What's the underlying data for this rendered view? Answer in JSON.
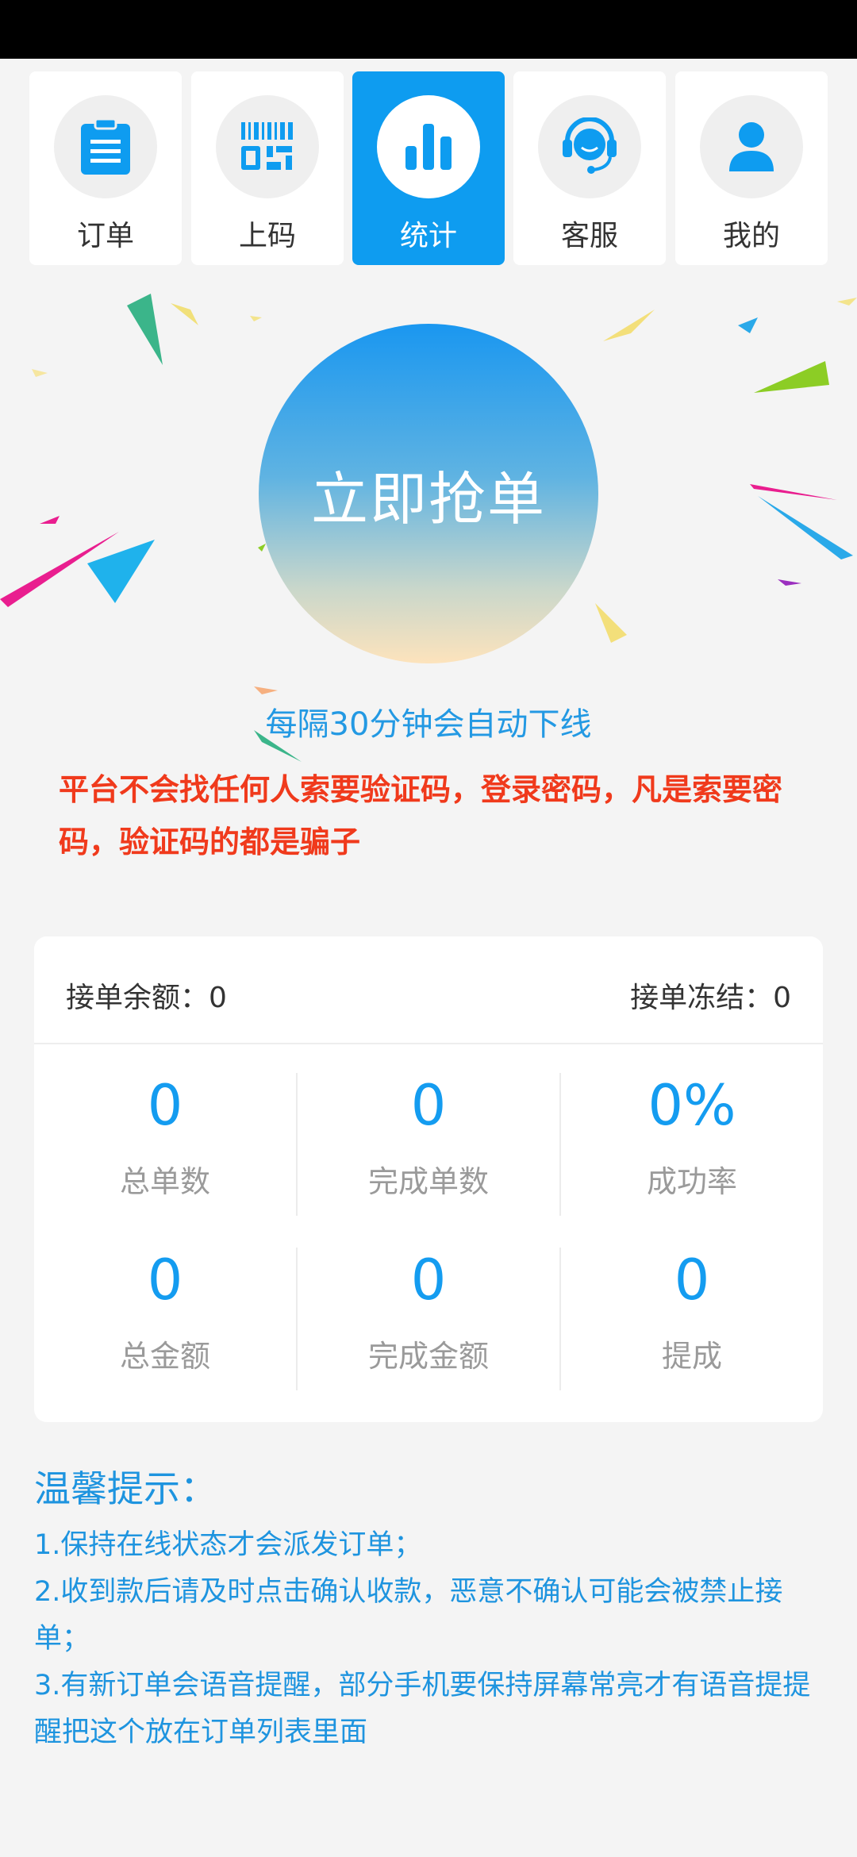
{
  "nav": {
    "tabs": [
      {
        "label": "订单",
        "icon": "clipboard-icon",
        "active": false
      },
      {
        "label": "上码",
        "icon": "barcode-icon",
        "active": false
      },
      {
        "label": "统计",
        "icon": "bar-chart-icon",
        "active": true
      },
      {
        "label": "客服",
        "icon": "headset-icon",
        "active": false
      },
      {
        "label": "我的",
        "icon": "user-icon",
        "active": false
      }
    ]
  },
  "grab": {
    "label": "立即抢单"
  },
  "notice": {
    "auto_offline": "每隔30分钟会自动下线",
    "warning": "平台不会找任何人索要验证码，登录密码，凡是索要密码，验证码的都是骗子"
  },
  "stats": {
    "balance": "接单余额：0",
    "frozen": "接单冻结：0",
    "cells": [
      {
        "value": "0",
        "label": "总单数"
      },
      {
        "value": "0",
        "label": "完成单数"
      },
      {
        "value": "0%",
        "label": "成功率"
      },
      {
        "value": "0",
        "label": "总金额"
      },
      {
        "value": "0",
        "label": "完成金额"
      },
      {
        "value": "0",
        "label": "提成"
      }
    ]
  },
  "tips": {
    "title": "温馨提示：",
    "items": [
      "1.保持在线状态才会派发订单；",
      "2.收到款后请及时点击确认收款，恶意不确认可能会被禁止接单；",
      "3.有新订单会语音提醒，部分手机要保持屏幕常亮才有语音提提醒把这个放在订单列表里面"
    ]
  },
  "colors": {
    "accent": "#0e9cf0",
    "warning": "#f03a1c",
    "tip": "#1e94df"
  }
}
